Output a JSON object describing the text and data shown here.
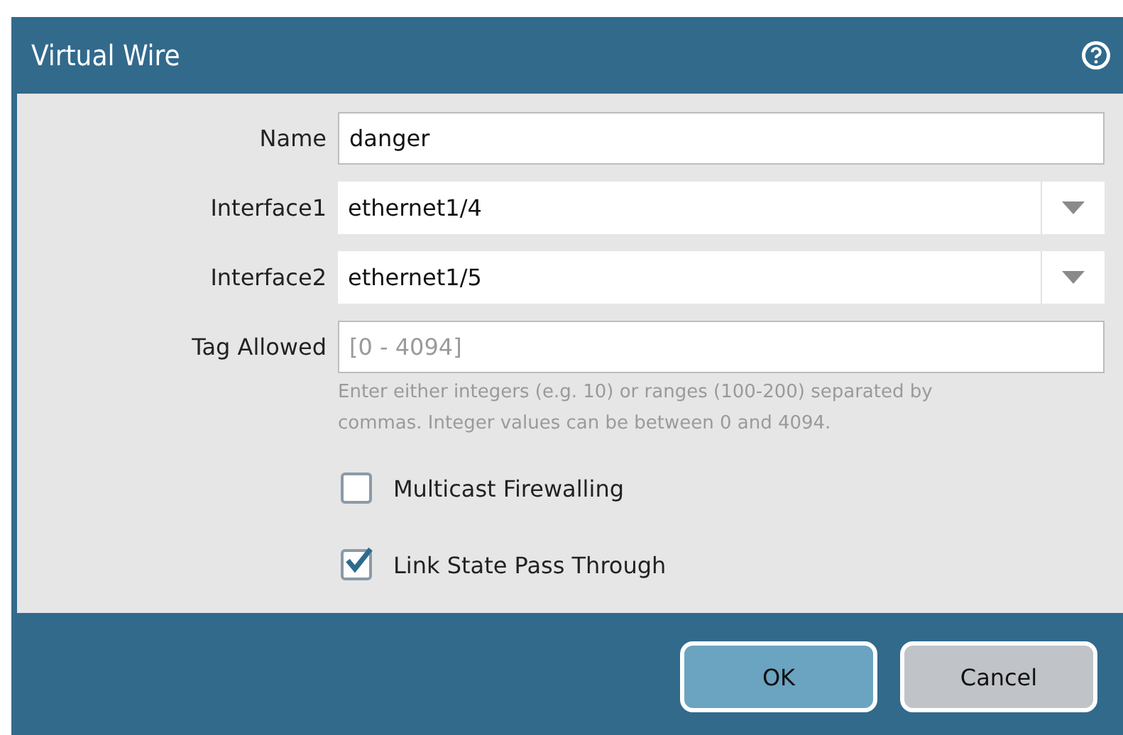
{
  "window": {
    "title": "Virtual Wire"
  },
  "fields": [
    {
      "kind": "text",
      "label": "Name",
      "value": "danger"
    },
    {
      "kind": "dropdown",
      "label": "Interface1",
      "value": "ethernet1/4"
    },
    {
      "kind": "dropdown",
      "label": "Interface2",
      "value": "ethernet1/5"
    },
    {
      "kind": "text",
      "label": "Tag Allowed",
      "placeholder": "[0 - 4094]",
      "hint": "Enter either integers (e.g. 10) or ranges (100-200) separated by commas. Integer values can be between 0 and 4094."
    }
  ],
  "checkboxes": [
    {
      "label": "Multicast Firewalling",
      "checked": false
    },
    {
      "label": "Link State Pass Through",
      "checked": true
    }
  ],
  "buttons": [
    {
      "label": "OK",
      "kind": "primary"
    },
    {
      "label": "Cancel",
      "kind": "secondary"
    }
  ]
}
